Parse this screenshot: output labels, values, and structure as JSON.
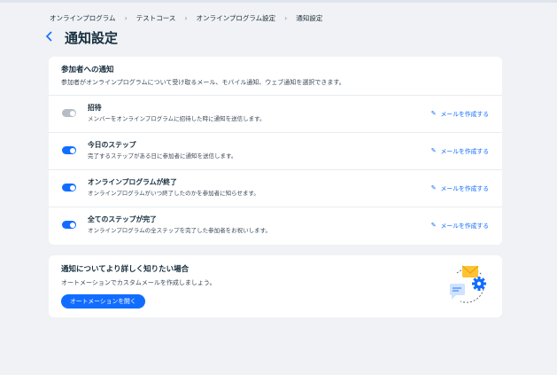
{
  "breadcrumb": {
    "items": [
      "オンラインプログラム",
      "テストコース",
      "オンラインプログラム設定",
      "通知設定"
    ]
  },
  "header": {
    "title": "通知設定",
    "back_icon": "chevron-left-icon"
  },
  "participants": {
    "title": "参加者への通知",
    "subtitle": "参加者がオンラインプログラムについて受け取るメール、モバイル通知、ウェブ通知を選択できます。",
    "rows": [
      {
        "title": "招待",
        "desc": "メンバーをオンラインプログラムに招待した時に通知を送信します。",
        "enabled": false,
        "action": "メールを作成する"
      },
      {
        "title": "今日のステップ",
        "desc": "完了するステップがある日に参加者に通知を送信します。",
        "enabled": true,
        "action": "メールを作成する"
      },
      {
        "title": "オンラインプログラムが終了",
        "desc": "オンラインプログラムがいつ終了したのかを参加者に知らせます。",
        "enabled": true,
        "action": "メールを作成する"
      },
      {
        "title": "全てのステップが完了",
        "desc": "オンラインプログラムの全ステップを完了した参加者をお祝いします。",
        "enabled": true,
        "action": "メールを作成する"
      }
    ]
  },
  "learn_more": {
    "title": "通知についてより詳しく知りたい場合",
    "desc": "オートメーションでカスタムメールを作成しましょう。",
    "button": "オートメーションを開く"
  },
  "colors": {
    "accent": "#116dff",
    "toggle_off": "#b6bdc6",
    "background": "#f0f2f5",
    "envelope": "#ffc233"
  }
}
